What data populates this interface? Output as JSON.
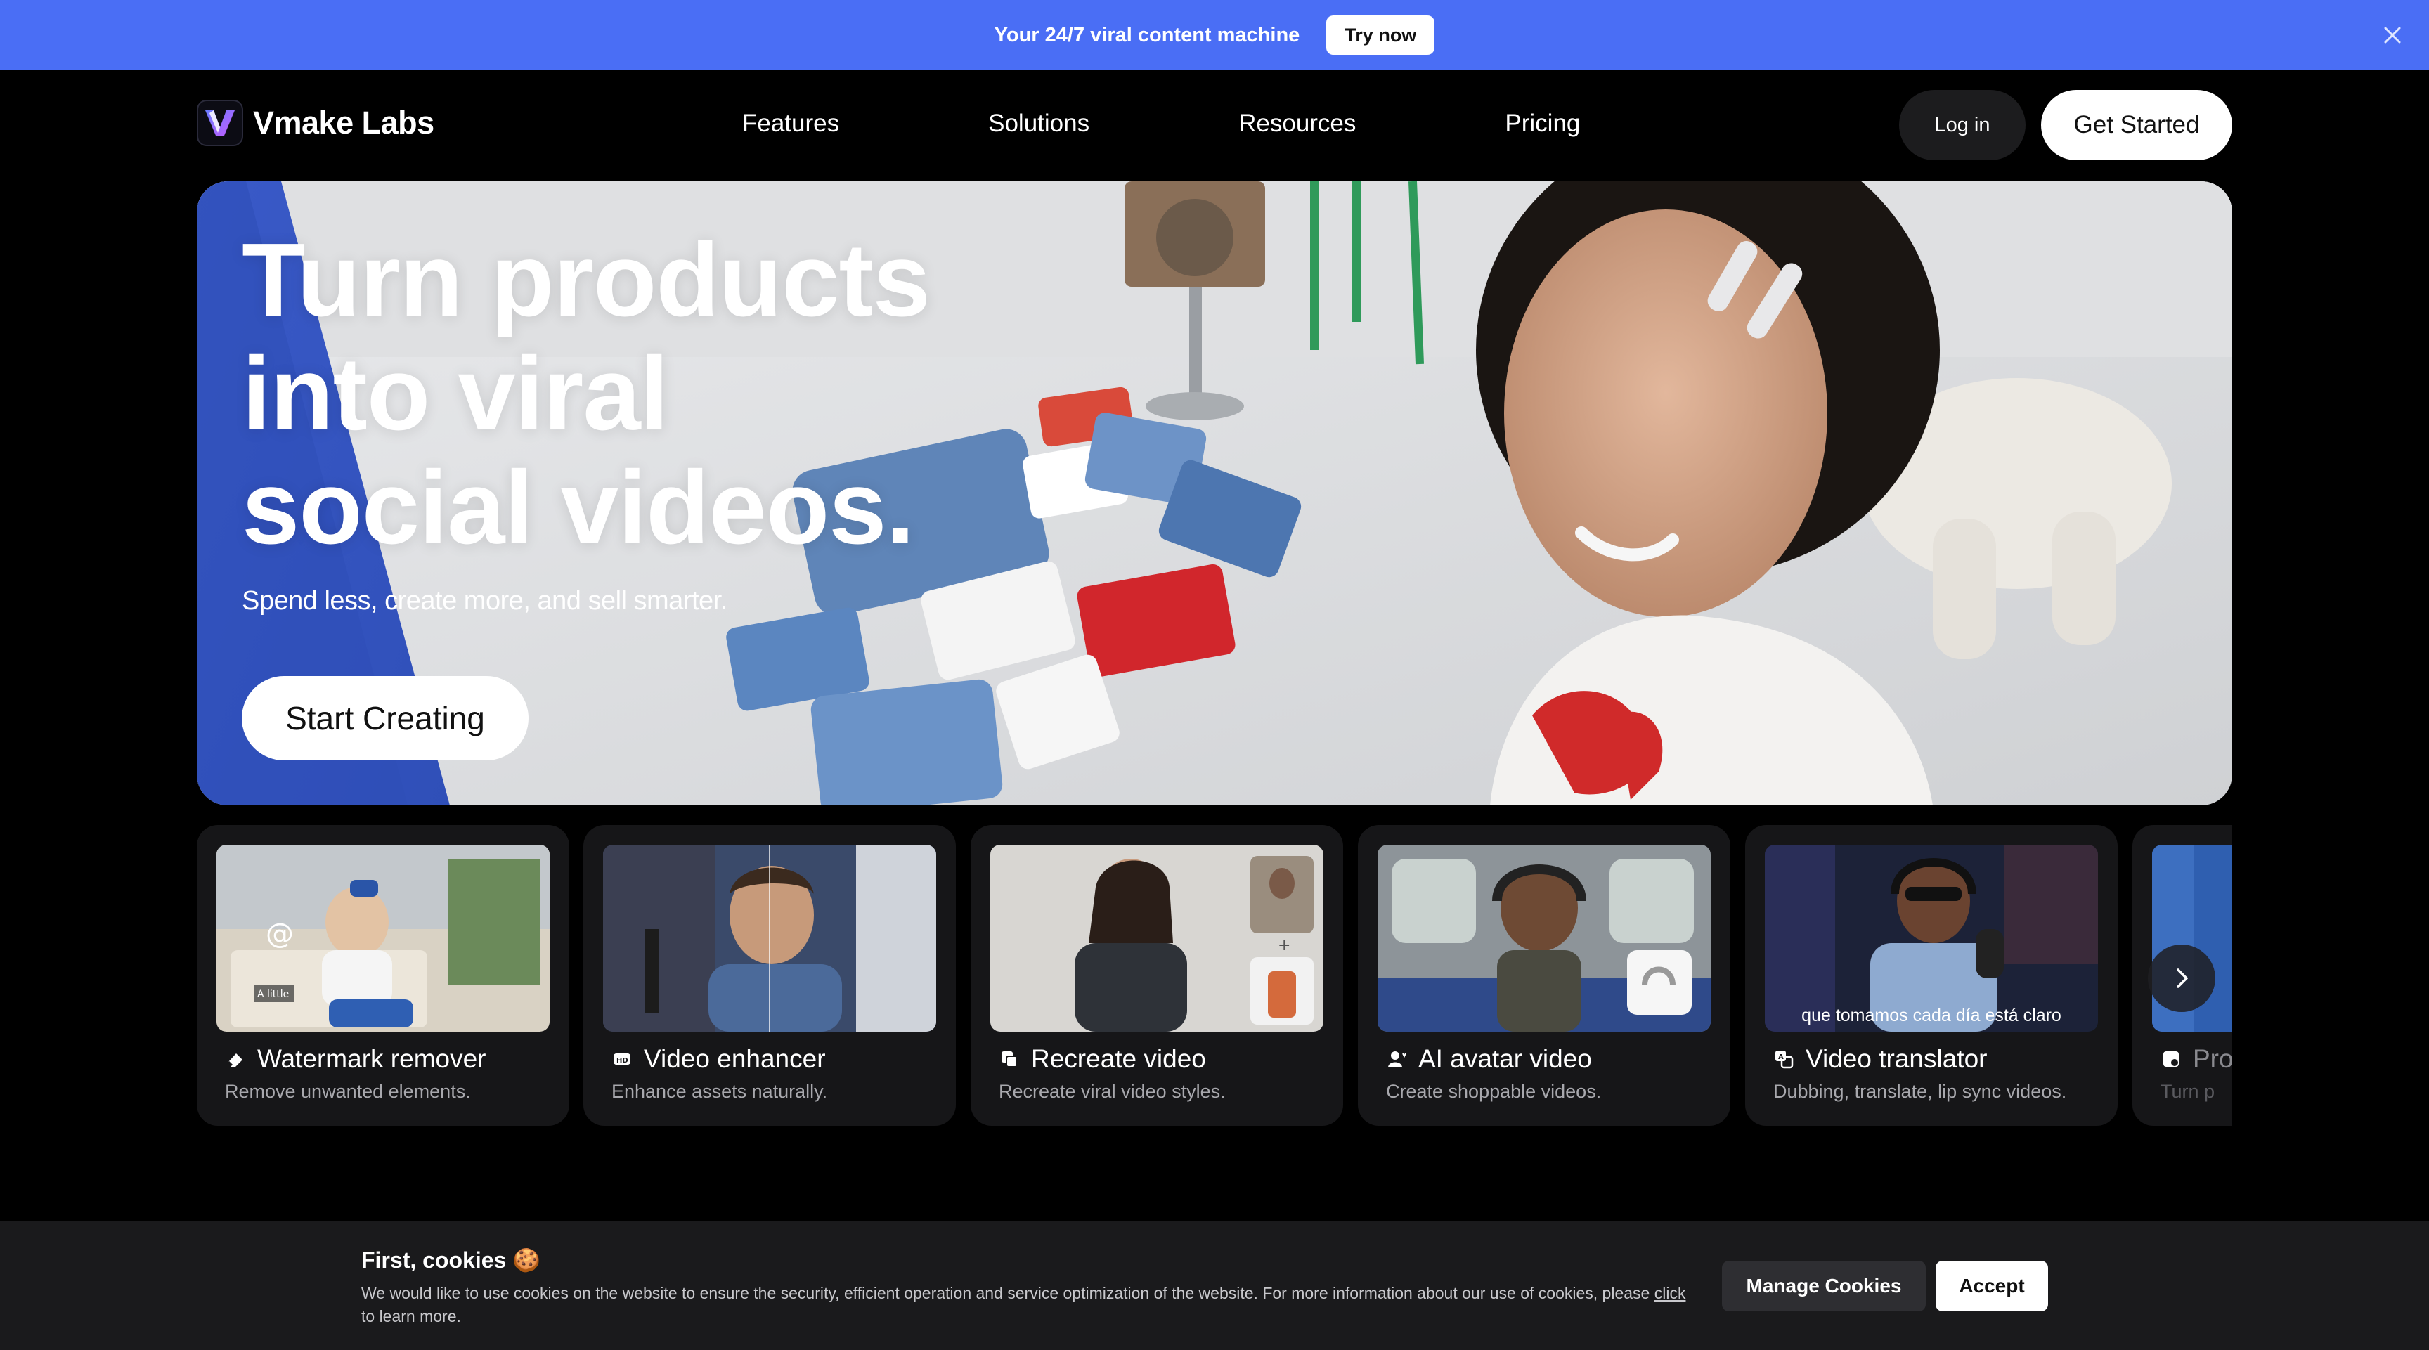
{
  "announcement": {
    "text": "Your 24/7 viral content machine",
    "button": "Try now",
    "close_icon": "close-icon",
    "bg_color": "#4a6ef5"
  },
  "nav": {
    "brand": "Vmake Labs",
    "links": [
      "Features",
      "Solutions",
      "Resources",
      "Pricing"
    ],
    "login": "Log in",
    "get_started": "Get Started"
  },
  "hero": {
    "title_line1": "Turn products",
    "title_line2": "into viral",
    "title_line3": "social videos.",
    "subtitle": "Spend less, create more, and sell smarter.",
    "cta": "Start Creating"
  },
  "cards": [
    {
      "title": "Watermark remover",
      "desc": "Remove unwanted elements.",
      "icon": "eraser-icon",
      "thumb_label": "A little"
    },
    {
      "title": "Video enhancer",
      "desc": "Enhance assets naturally.",
      "icon": "hd-icon"
    },
    {
      "title": "Recreate video",
      "desc": "Recreate viral video styles.",
      "icon": "recreate-icon"
    },
    {
      "title": "AI avatar video",
      "desc": "Create shoppable videos.",
      "icon": "avatar-icon"
    },
    {
      "title": "Video translator",
      "desc": "Dubbing, translate, lip sync videos.",
      "icon": "translate-icon",
      "caption": "que tomamos cada día está claro"
    },
    {
      "title": "Pro",
      "desc": "Turn p",
      "icon": "product-icon"
    }
  ],
  "cookie": {
    "title": "First, cookies 🍪",
    "text_before_link": "We would like to use cookies on the website to ensure the security, efficient operation and service optimization of the website. For more information about our use of cookies, please ",
    "link": "click",
    "text_after_link": " to learn more.",
    "manage": "Manage Cookies",
    "accept": "Accept"
  }
}
